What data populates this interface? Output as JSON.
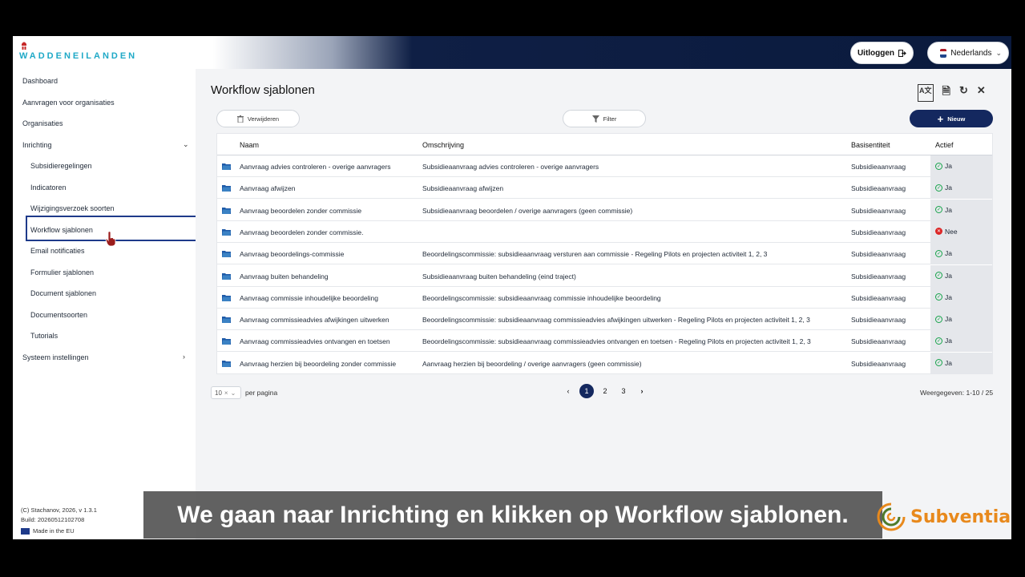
{
  "header": {
    "logo_text": "WADDENEILANDEN",
    "logout_label": "Uitloggen",
    "language": "Nederlands"
  },
  "sidebar": {
    "items": [
      {
        "label": "Dashboard"
      },
      {
        "label": "Aanvragen voor organisaties"
      },
      {
        "label": "Organisaties"
      },
      {
        "label": "Inrichting"
      },
      {
        "label": "Subsidieregelingen"
      },
      {
        "label": "Indicatoren"
      },
      {
        "label": "Wijzigingsverzoek soorten"
      },
      {
        "label": "Workflow sjablonen"
      },
      {
        "label": "Email notificaties"
      },
      {
        "label": "Formulier sjablonen"
      },
      {
        "label": "Document sjablonen"
      },
      {
        "label": "Documentsoorten"
      },
      {
        "label": "Tutorials"
      },
      {
        "label": "Systeem instellingen"
      }
    ],
    "footer": {
      "copyright": "(C) Stachanov, 2026, v 1.3.1",
      "build": "Build: 20260512102708",
      "made_in": "Made in the EU"
    }
  },
  "main": {
    "title": "Workflow sjablonen",
    "delete_label": "Verwijderen",
    "filter_label": "Filter",
    "new_label": "Nieuw",
    "columns": [
      "Naam",
      "Omschrijving",
      "Basisentiteit",
      "Actief"
    ],
    "rows": [
      {
        "naam": "Aanvraag advies controleren - overige aanvragers",
        "omschrijving": "Subsidieaanvraag advies controleren - overige aanvragers",
        "basis": "Subsidieaanvraag",
        "actief": "Ja"
      },
      {
        "naam": "Aanvraag afwijzen",
        "omschrijving": "Subsidieaanvraag afwijzen",
        "basis": "Subsidieaanvraag",
        "actief": "Ja"
      },
      {
        "naam": "Aanvraag beoordelen zonder commissie",
        "omschrijving": "Subsidieaanvraag beoordelen / overige aanvragers (geen commissie)",
        "basis": "Subsidieaanvraag",
        "actief": "Ja"
      },
      {
        "naam": "Aanvraag beoordelen zonder commissie.",
        "omschrijving": "",
        "basis": "Subsidieaanvraag",
        "actief": "Nee"
      },
      {
        "naam": "Aanvraag beoordelings-commissie",
        "omschrijving": "Beoordelingscommissie: subsidieaanvraag versturen aan commissie - Regeling Pilots en projecten activiteit 1, 2, 3",
        "basis": "Subsidieaanvraag",
        "actief": "Ja"
      },
      {
        "naam": "Aanvraag buiten behandeling",
        "omschrijving": "Subsidieaanvraag buiten behandeling (eind traject)",
        "basis": "Subsidieaanvraag",
        "actief": "Ja"
      },
      {
        "naam": "Aanvraag commissie inhoudelijke beoordeling",
        "omschrijving": "Beoordelingscommissie: subsidieaanvraag commissie inhoudelijke beoordeling",
        "basis": "Subsidieaanvraag",
        "actief": "Ja"
      },
      {
        "naam": "Aanvraag commissieadvies afwijkingen uitwerken",
        "omschrijving": "Beoordelingscommissie: subsidieaanvraag commissieadvies afwijkingen uitwerken - Regeling Pilots en projecten activiteit 1, 2, 3",
        "basis": "Subsidieaanvraag",
        "actief": "Ja"
      },
      {
        "naam": "Aanvraag commissieadvies ontvangen en toetsen",
        "omschrijving": "Beoordelingscommissie: subsidieaanvraag commissieadvies ontvangen en toetsen - Regeling Pilots en projecten activiteit 1, 2, 3",
        "basis": "Subsidieaanvraag",
        "actief": "Ja"
      },
      {
        "naam": "Aanvraag herzien bij beoordeling zonder commissie",
        "omschrijving": "Aanvraag herzien bij beoordeling / overige aanvragers (geen commissie)",
        "basis": "Subsidieaanvraag",
        "actief": "Ja"
      }
    ],
    "per_page_value": "10",
    "per_page_label": "per pagina",
    "pages": [
      "1",
      "2",
      "3"
    ],
    "shown": "Weergegeven: 1-10 / 25"
  },
  "overlay": {
    "subtitle": "We gaan naar Inrichting en klikken op Workflow sjablonen.",
    "brand": "Subventia"
  },
  "colors": {
    "accent": "#14285f",
    "active_ok": "#16a34a",
    "inactive": "#dc2626",
    "brand": "#e8891c"
  }
}
